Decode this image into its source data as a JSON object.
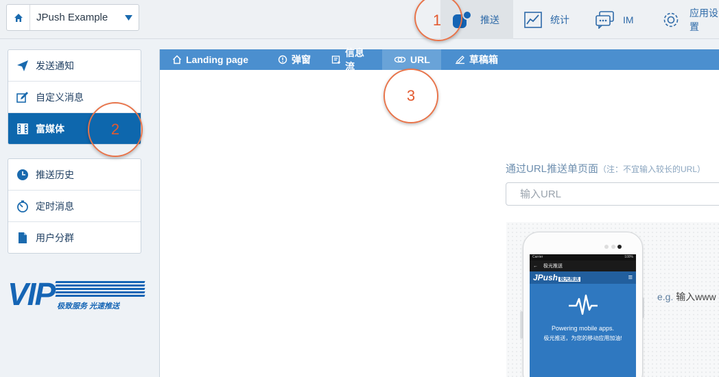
{
  "top": {
    "app_name": "JPush Example",
    "nav": [
      {
        "id": "push",
        "label": "推送",
        "icon": "push-bubble-icon"
      },
      {
        "id": "stats",
        "label": "统计",
        "icon": "line-chart-icon"
      },
      {
        "id": "im",
        "label": "IM",
        "icon": "chat-icon"
      },
      {
        "id": "settings",
        "label": "应用设置",
        "icon": "gear-icon"
      }
    ]
  },
  "annotations": [
    "1",
    "2",
    "3"
  ],
  "sidebar": {
    "group1": [
      {
        "label": "发送通知",
        "icon": "paper-plane-icon"
      },
      {
        "label": "自定义消息",
        "icon": "edit-icon"
      },
      {
        "label": "富媒体",
        "icon": "film-icon",
        "active": true
      }
    ],
    "group2": [
      {
        "label": "推送历史",
        "icon": "clock-icon"
      },
      {
        "label": "定时消息",
        "icon": "timer-icon"
      },
      {
        "label": "用户分群",
        "icon": "document-icon"
      }
    ],
    "vip": {
      "logo": "VIP",
      "slogan": "极致服务 光速推送"
    }
  },
  "tabs": [
    {
      "label": "Landing page",
      "icon": "home-outline-icon"
    },
    {
      "label": "弹窗",
      "icon": "alert-circle-icon"
    },
    {
      "label": "信息流",
      "icon": "feed-icon"
    },
    {
      "label": "URL",
      "icon": "link-icon",
      "active": true
    },
    {
      "label": "草稿箱",
      "icon": "draft-icon"
    }
  ],
  "url_form": {
    "title": "通过URL推送单页面",
    "note": "（注：不宜输入较长的URL）",
    "placeholder": "输入URL",
    "example_prefix": "e.g.",
    "example_text": "输入www"
  },
  "phone_preview": {
    "carrier": "Carrier",
    "battery": "100%",
    "appbar_title": "极光推送",
    "brand": "JPush",
    "brand_sub": "极光推送",
    "tagline": "Powering mobile apps.",
    "tagline_cn": "极光推送，为您的移动应用加油!"
  },
  "colors": {
    "primary": "#0e67ad",
    "tab_bar": "#4b8fcf",
    "annotation": "#e8744a"
  }
}
